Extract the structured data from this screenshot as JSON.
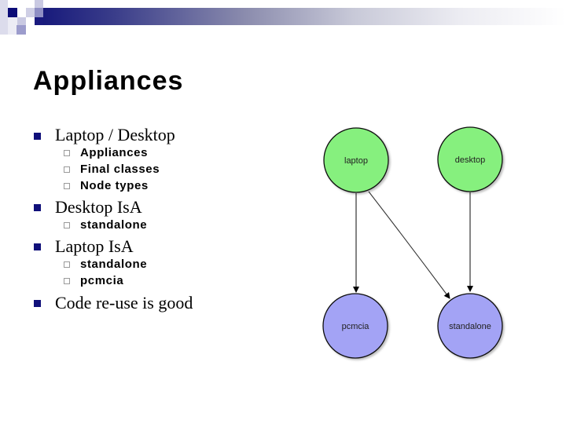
{
  "slide": {
    "title": "Appliances",
    "bullets": [
      {
        "text": "Laptop / Desktop",
        "children": [
          "Appliances",
          "Final classes",
          "Node types"
        ]
      },
      {
        "text": "Desktop IsA",
        "children": [
          "standalone"
        ]
      },
      {
        "text": "Laptop IsA",
        "children": [
          "standalone",
          "pcmcia"
        ]
      },
      {
        "text": "Code re-use is good",
        "children": []
      }
    ]
  },
  "diagram": {
    "nodes": [
      {
        "id": "laptop",
        "label": "laptop",
        "color": "#86f07e"
      },
      {
        "id": "desktop",
        "label": "desktop",
        "color": "#86f07e"
      },
      {
        "id": "pcmcia",
        "label": "pcmcia",
        "color": "#a3a3f5"
      },
      {
        "id": "standalone",
        "label": "standalone",
        "color": "#a3a3f5"
      }
    ],
    "edges": [
      {
        "from": "laptop",
        "to": "pcmcia"
      },
      {
        "from": "laptop",
        "to": "standalone"
      },
      {
        "from": "desktop",
        "to": "standalone"
      }
    ]
  },
  "theme": {
    "accent": "#14167a",
    "bullet_color": "#10107a"
  }
}
